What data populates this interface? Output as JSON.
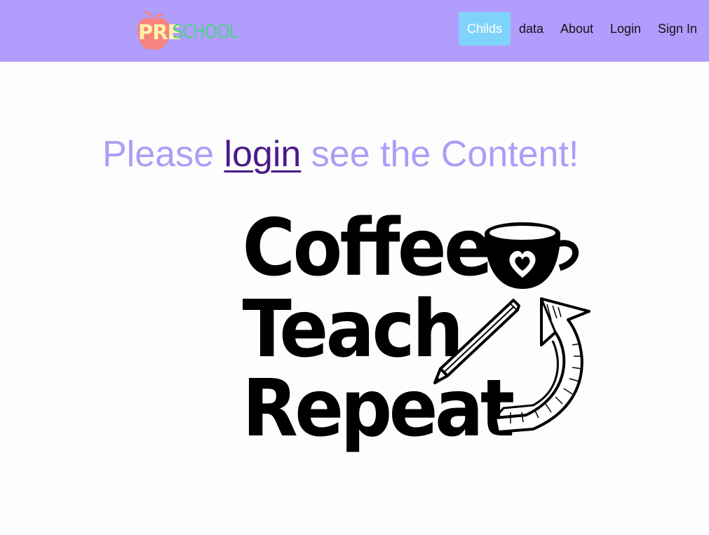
{
  "logo": {
    "prefix": "PRE",
    "suffix": "SCHOOL",
    "apple_color": "#f7837f"
  },
  "nav": {
    "items": [
      {
        "label": "Childs",
        "active": true
      },
      {
        "label": "data",
        "active": false
      },
      {
        "label": "About",
        "active": false
      },
      {
        "label": "Login",
        "active": false
      },
      {
        "label": "Sign In",
        "active": false
      }
    ]
  },
  "main": {
    "headline_before": "Please ",
    "headline_link": "login",
    "headline_after": " see the Content!"
  },
  "artwork": {
    "line1": "Coffee",
    "line2": "Teach",
    "line3": "Repeat",
    "icons": [
      "coffee-cup-icon",
      "heart-icon",
      "pencil-icon",
      "repeat-arrow-icon"
    ]
  },
  "colors": {
    "navbar_bg": "#b19dfc",
    "active_nav_bg": "#7fd3fb",
    "headline": "#ad9df6",
    "link": "#4b1a87"
  }
}
